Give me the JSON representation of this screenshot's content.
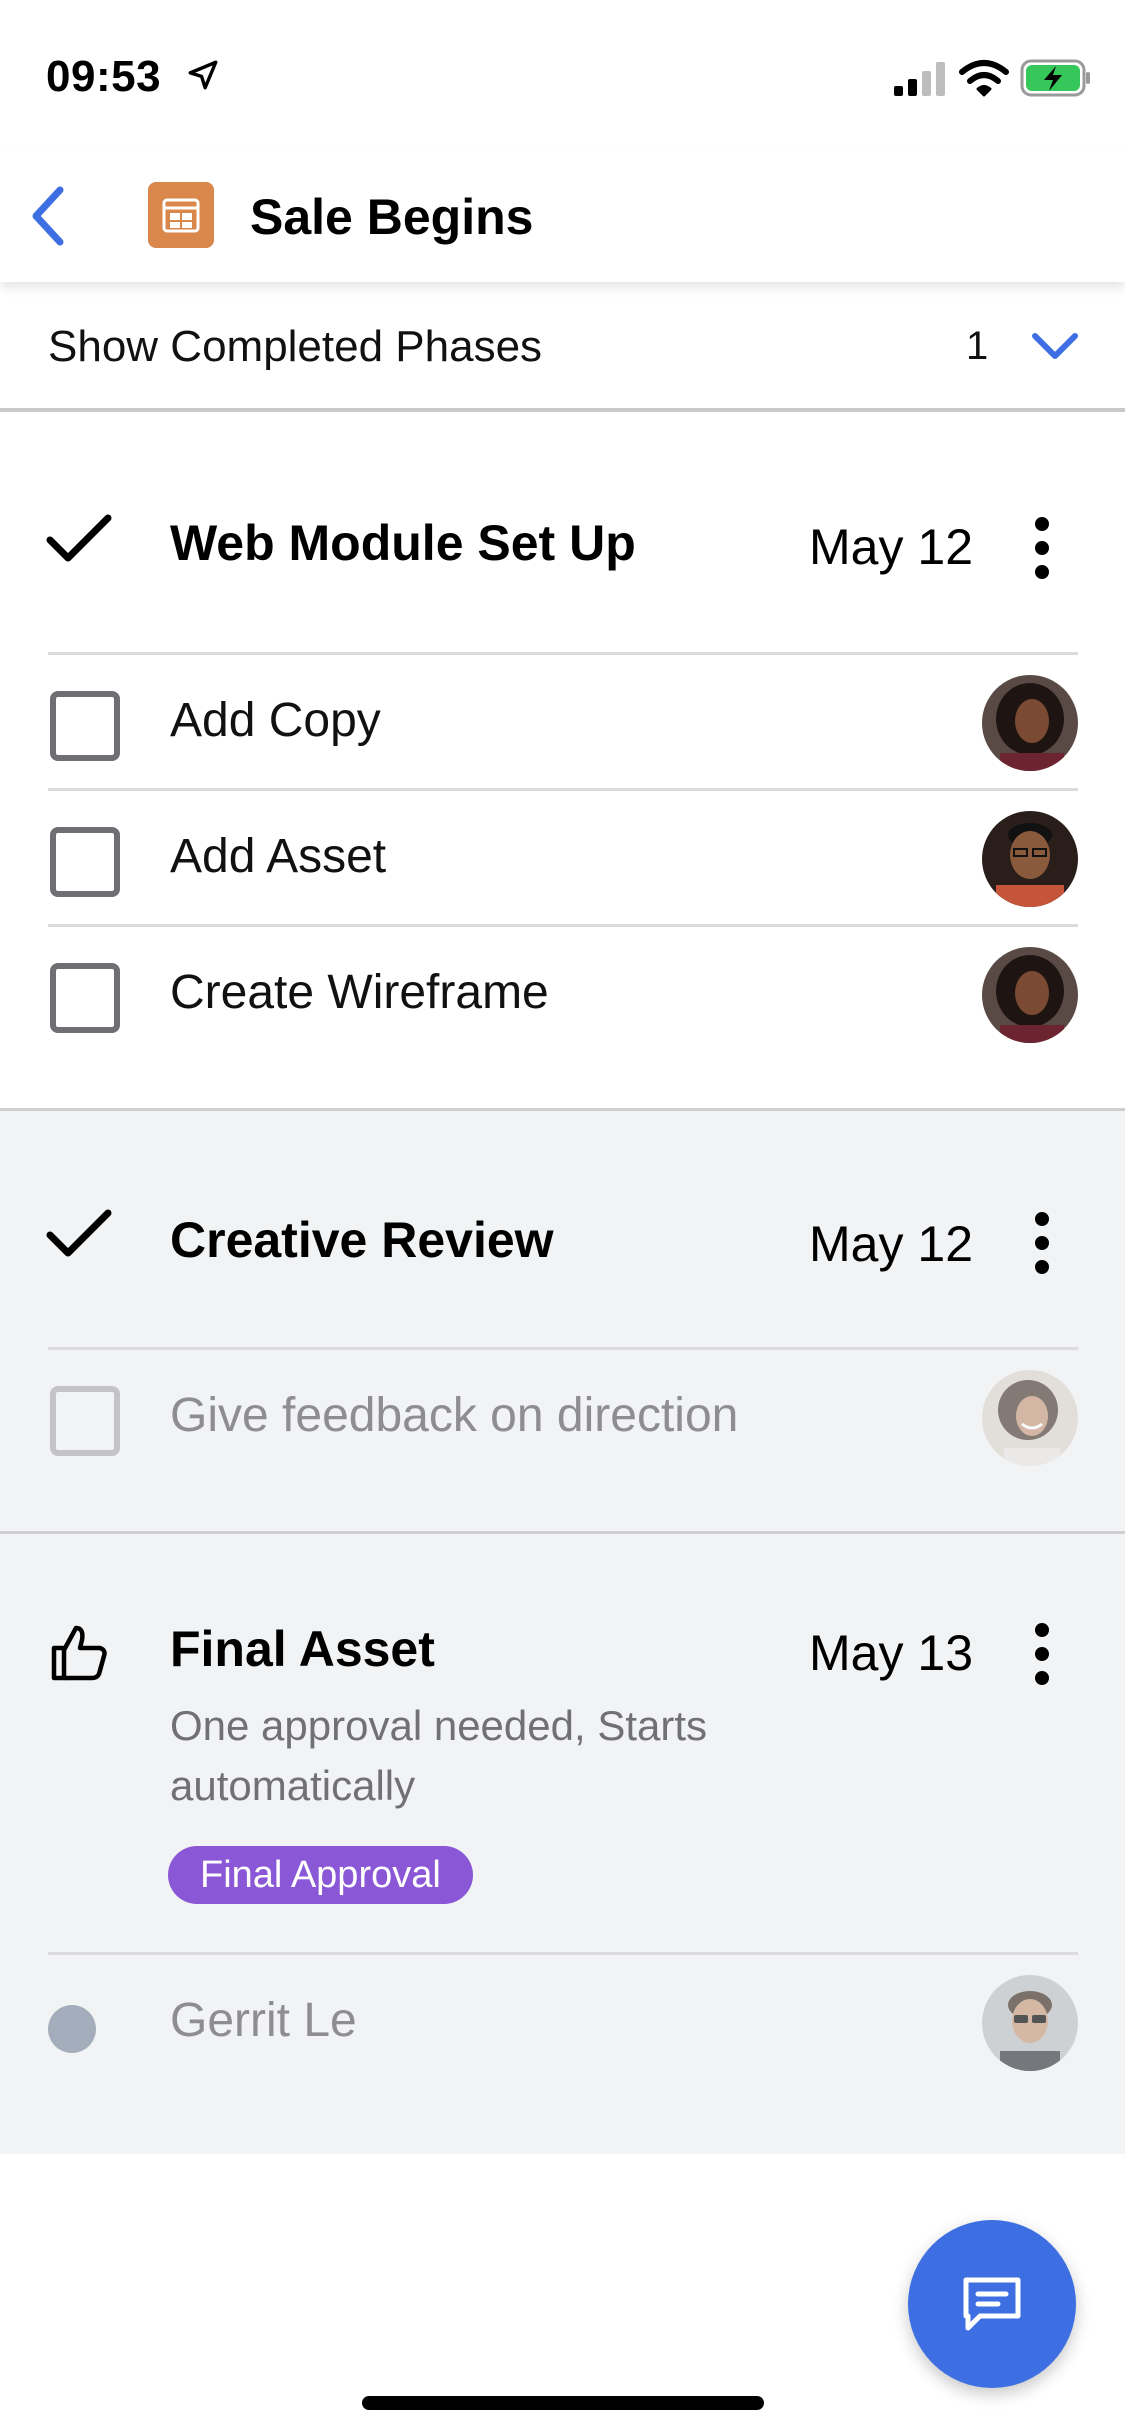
{
  "status_bar": {
    "time": "09:53",
    "icons": [
      "location-arrow-icon",
      "cellular-signal-icon",
      "wifi-icon",
      "battery-charging-icon"
    ]
  },
  "nav": {
    "back_icon": "chevron-left-icon",
    "app_icon": "calendar-icon",
    "title": "Sale Begins"
  },
  "completed_toggle": {
    "label": "Show Completed Phases",
    "count": "1",
    "icon": "chevron-down-icon"
  },
  "phases": [
    {
      "status_icon": "checkmark-icon",
      "title": "Web Module Set Up",
      "date": "May 12",
      "tasks": [
        {
          "label": "Add Copy",
          "completed": false,
          "avatar": "avatar-woman-curly-hair"
        },
        {
          "label": "Add Asset",
          "completed": false,
          "avatar": "avatar-man-glasses"
        },
        {
          "label": "Create Wireframe",
          "completed": false,
          "avatar": "avatar-woman-curly-hair"
        }
      ]
    },
    {
      "status_icon": "checkmark-icon",
      "title": "Creative Review",
      "date": "May 12",
      "tasks": [
        {
          "label": "Give feedback on direction",
          "completed": false,
          "avatar": "avatar-woman-laughing"
        }
      ]
    },
    {
      "status_icon": "thumbs-up-icon",
      "title": "Final Asset",
      "date": "May 13",
      "subtitle": "One approval needed, Starts automatically",
      "badge": "Final Approval",
      "approvers": [
        {
          "label": "Gerrit Le",
          "avatar": "avatar-man-sunglasses"
        }
      ]
    }
  ],
  "fab": {
    "icon": "message-icon"
  },
  "colors": {
    "accent_blue": "#3d6fe3",
    "app_icon_orange": "#d9874b",
    "badge_purple": "#8a58d6",
    "section_grey": "#f2f3f5",
    "status_dot": "#a3adbb"
  }
}
